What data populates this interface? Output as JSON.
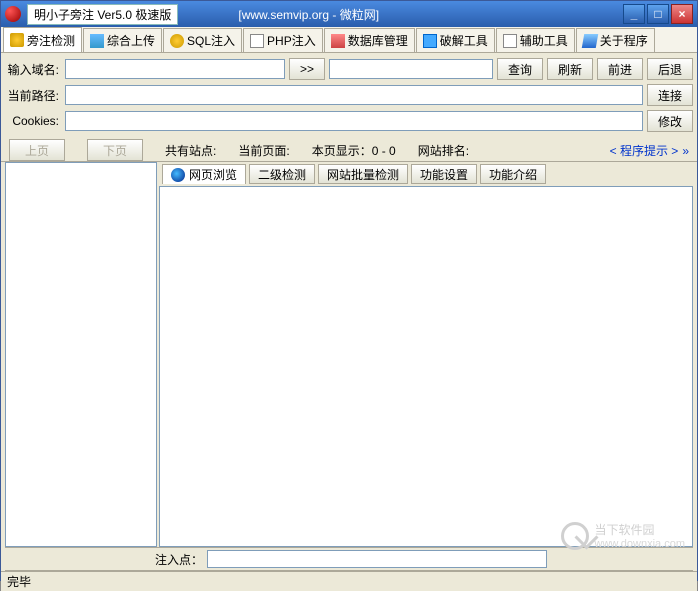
{
  "titlebar": {
    "title": "明小子旁注 Ver5.0 极速版",
    "subtitle": "[www.semvip.org - 微粒网]"
  },
  "winctrl": {
    "min": "_",
    "max": "□",
    "close": "×"
  },
  "tabs": [
    {
      "label": "旁注检测",
      "icon": "db-icon"
    },
    {
      "label": "综合上传",
      "icon": "chart-icon"
    },
    {
      "label": "SQL注入",
      "icon": "sql-icon"
    },
    {
      "label": "PHP注入",
      "icon": "php-icon"
    },
    {
      "label": "数据库管理",
      "icon": "dbm-icon"
    },
    {
      "label": "破解工具",
      "icon": "crack-icon"
    },
    {
      "label": "辅助工具",
      "icon": "aux-icon"
    },
    {
      "label": "关于程序",
      "icon": "about-icon"
    }
  ],
  "form": {
    "domain_label": "输入域名:",
    "domain_value": "",
    "go_label": ">>",
    "url_value": "",
    "query_btn": "查询",
    "refresh_btn": "刷新",
    "forward_btn": "前进",
    "back_btn": "后退",
    "path_label": "当前路径:",
    "path_value": "",
    "connect_btn": "连接",
    "cookies_label": "Cookies:",
    "cookies_value": "",
    "modify_btn": "修改"
  },
  "infobar": {
    "prev_btn": "上页",
    "next_btn": "下页",
    "shared_sites": "共有站点:",
    "current_page": "当前页面:",
    "page_display": "本页显示：0 - 0",
    "site_rank": "网站排名:",
    "program_hint": "< 程序提示 >"
  },
  "maintabs": {
    "browse": "网页浏览",
    "level2": "二级检测",
    "batch": "网站批量检测",
    "settings": "功能设置",
    "intro": "功能介绍"
  },
  "inject": {
    "label": "注入点：",
    "value": ""
  },
  "statusbar": {
    "text": "完毕"
  },
  "watermark": {
    "text": "当下软件园",
    "url": "www.downxia.com"
  }
}
